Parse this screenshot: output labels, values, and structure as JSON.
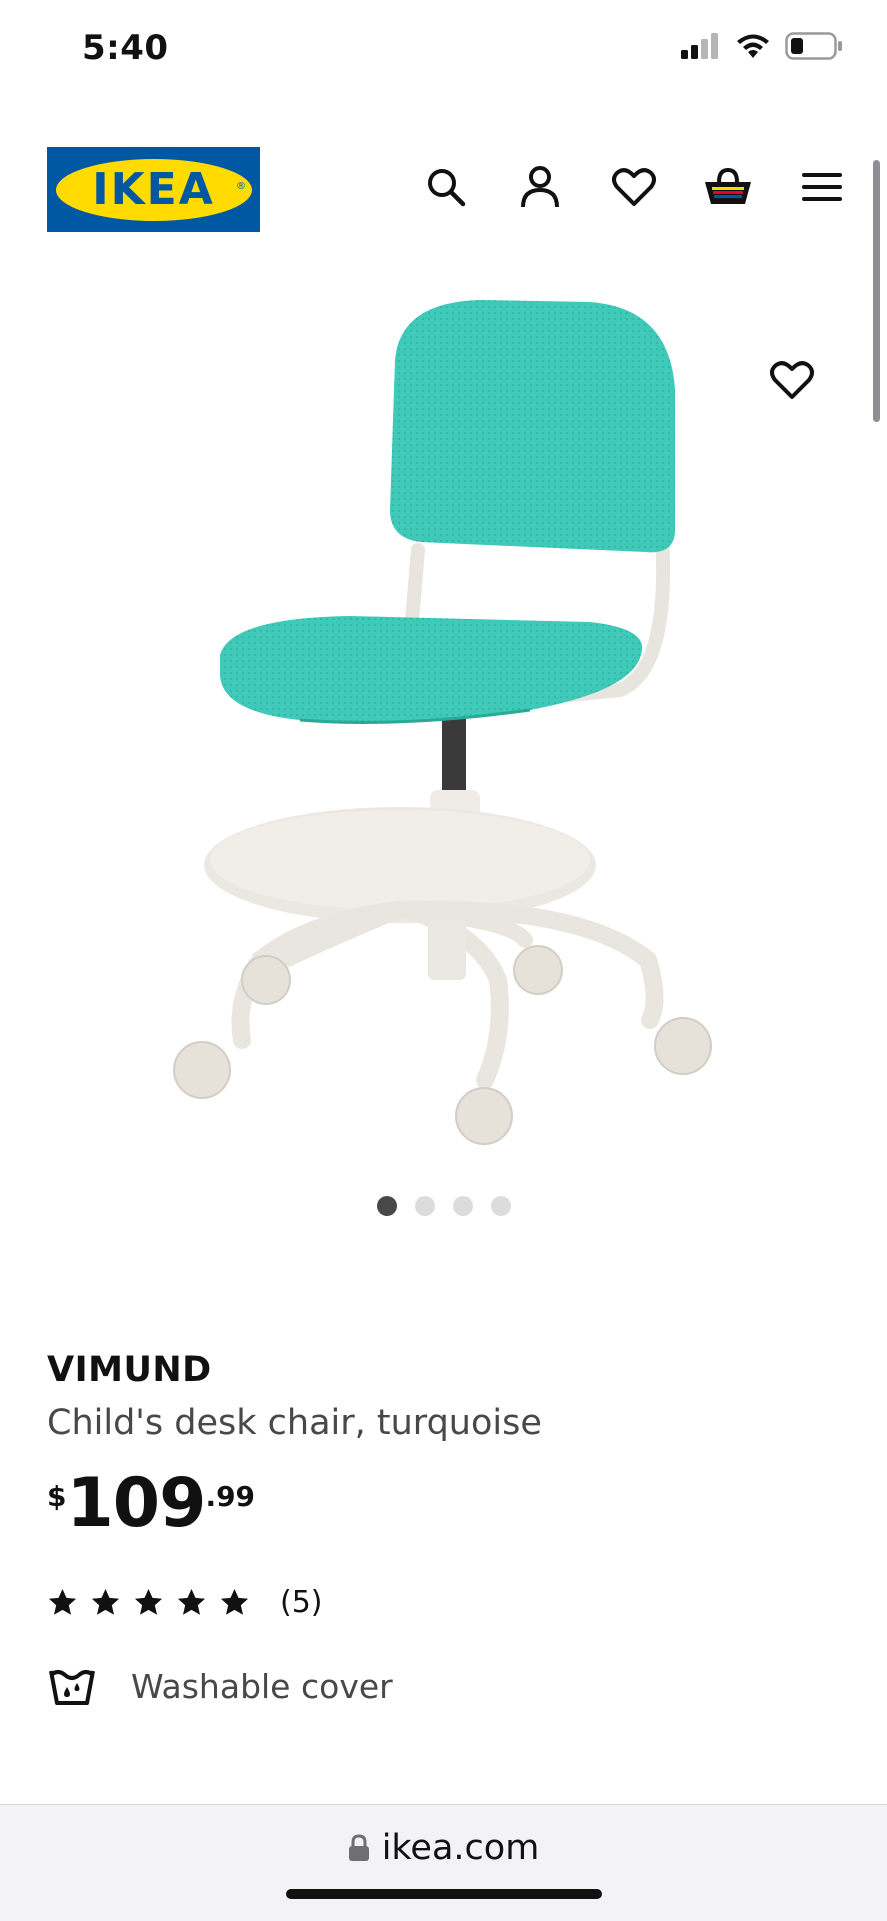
{
  "status_bar": {
    "time": "5:40"
  },
  "header": {
    "logo_text": "IKEA",
    "icons": [
      "search-icon",
      "account-icon",
      "heart-icon",
      "cart-icon",
      "menu-icon"
    ]
  },
  "gallery": {
    "image_count": 4,
    "active_index": 0
  },
  "product": {
    "name": "VIMUND",
    "description": "Child's desk chair, turquoise",
    "price": {
      "currency": "$",
      "integer": "109",
      "decimal": ".99"
    },
    "rating": {
      "stars": 5,
      "max": 5,
      "count_label": "(5)"
    },
    "feature": {
      "icon": "washable-icon",
      "label": "Washable cover"
    }
  },
  "browser": {
    "url": "ikea.com"
  },
  "colors": {
    "ikea_blue": "#0058a3",
    "ikea_yellow": "#ffdb00",
    "chair_turquoise": "#3fc9b9",
    "chair_frame": "#eeebe4"
  }
}
